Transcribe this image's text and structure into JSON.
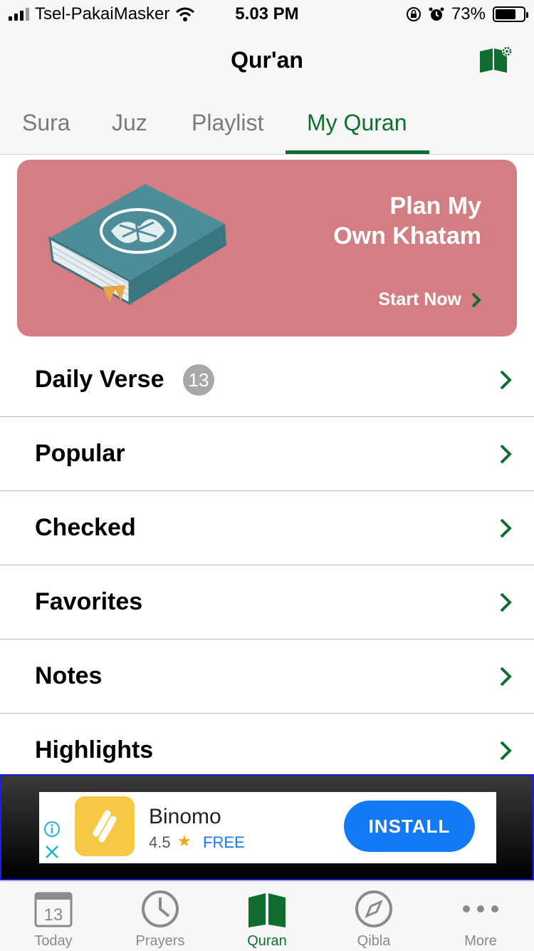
{
  "status_bar": {
    "carrier": "Tsel-PakaiMasker",
    "time": "5.03 PM",
    "battery": "73%",
    "battery_level": 0.73
  },
  "nav": {
    "title": "Qur'an",
    "action_icon": "book-settings-icon"
  },
  "tabs": [
    {
      "label": "Sura"
    },
    {
      "label": "Juz"
    },
    {
      "label": "Playlist"
    },
    {
      "label": "My Quran",
      "active": true
    }
  ],
  "banner": {
    "title_line1": "Plan My",
    "title_line2": "Own Khatam",
    "cta": "Start Now",
    "color": "#d47e84"
  },
  "list": [
    {
      "label": "Daily Verse",
      "badge": "13"
    },
    {
      "label": "Popular"
    },
    {
      "label": "Checked"
    },
    {
      "label": "Favorites"
    },
    {
      "label": "Notes"
    },
    {
      "label": "Highlights"
    }
  ],
  "ad": {
    "app_name": "Binomo",
    "rating": "4.5",
    "price": "FREE",
    "install_label": "INSTALL",
    "install_color": "#1479f5"
  },
  "tabbar": [
    {
      "label": "Today",
      "icon": "calendar-icon",
      "icon_text": "13"
    },
    {
      "label": "Prayers",
      "icon": "clock-icon"
    },
    {
      "label": "Quran",
      "icon": "book-icon",
      "active": true
    },
    {
      "label": "Qibla",
      "icon": "compass-icon"
    },
    {
      "label": "More",
      "icon": "more-icon"
    }
  ],
  "colors": {
    "accent": "#0f6e2f",
    "inactive": "#8a8a8a"
  }
}
